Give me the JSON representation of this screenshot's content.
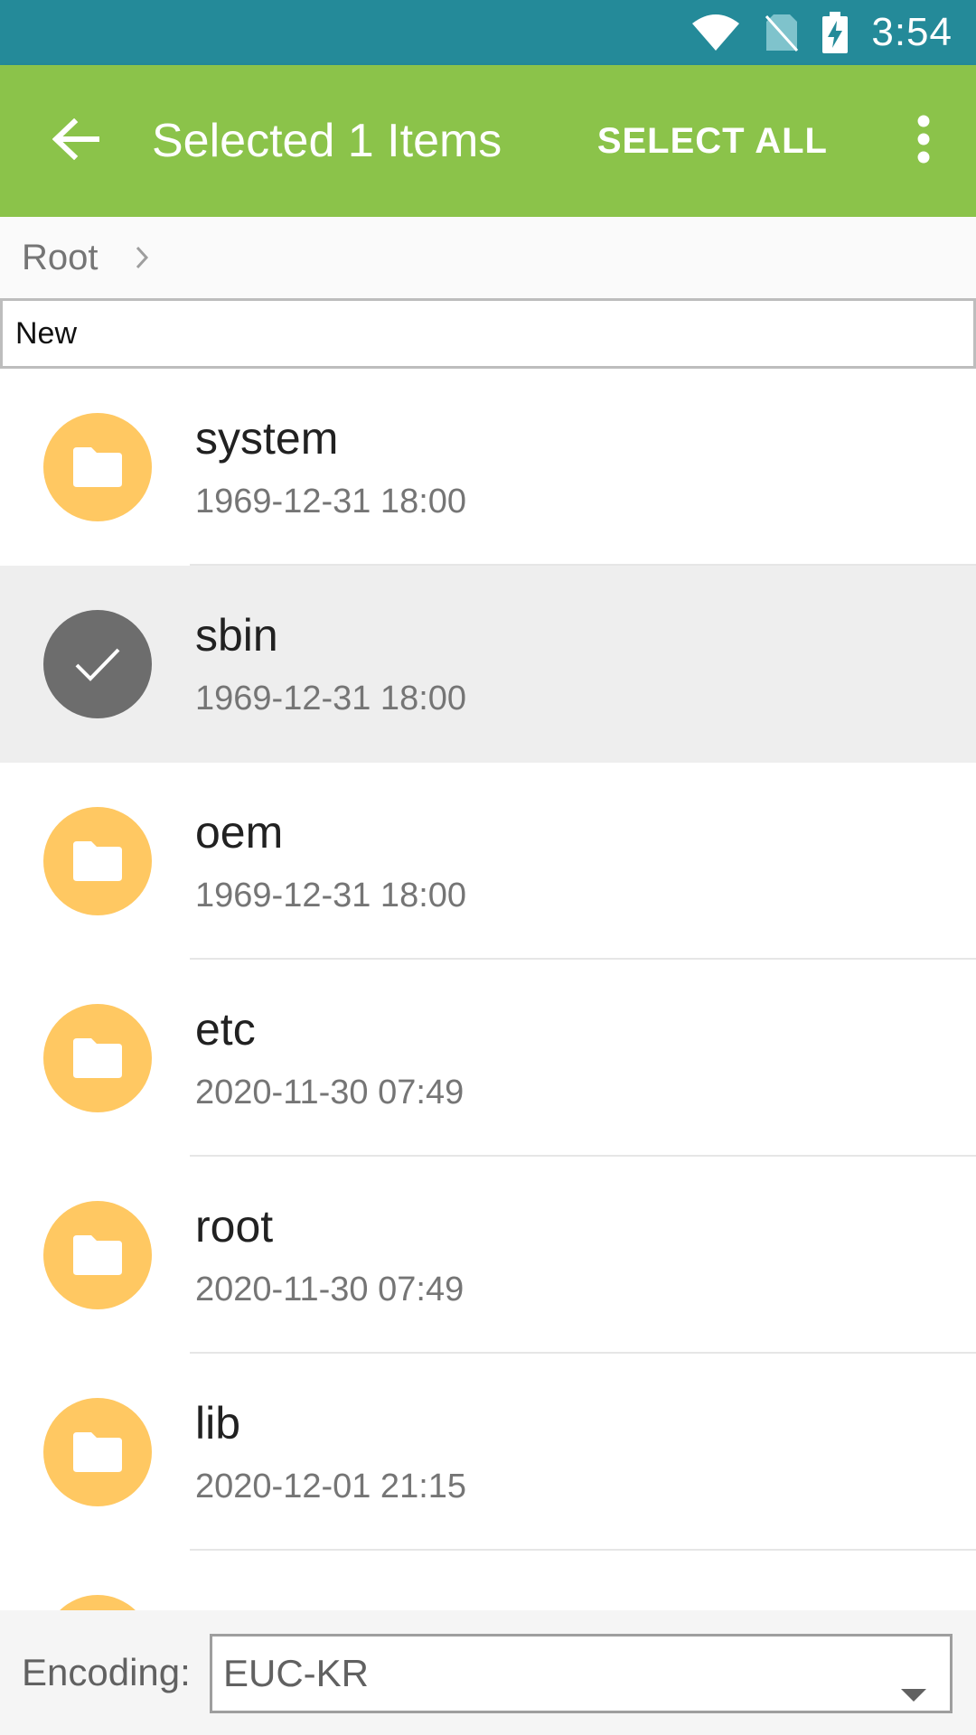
{
  "status_bar": {
    "time": "3:54",
    "icons": [
      "wifi-icon",
      "no-sim-icon",
      "battery-charging-icon"
    ]
  },
  "action_bar": {
    "title": "Selected 1 Items",
    "select_all_label": "SELECT ALL",
    "back_icon": "arrow-back-icon",
    "overflow_icon": "more-vert-icon"
  },
  "breadcrumb": {
    "root_label": "Root"
  },
  "new_box": {
    "label": "New"
  },
  "files": [
    {
      "name": "system",
      "date": "1969-12-31 18:00",
      "selected": false
    },
    {
      "name": "sbin",
      "date": "1969-12-31 18:00",
      "selected": true
    },
    {
      "name": "oem",
      "date": "1969-12-31 18:00",
      "selected": false
    },
    {
      "name": "etc",
      "date": "2020-11-30 07:49",
      "selected": false
    },
    {
      "name": "root",
      "date": "2020-11-30 07:49",
      "selected": false
    },
    {
      "name": "lib",
      "date": "2020-12-01 21:15",
      "selected": false
    }
  ],
  "encoding": {
    "label": "Encoding:",
    "value": "EUC-KR"
  },
  "colors": {
    "status_bar": "#248a99",
    "action_bar": "#8bc34a",
    "folder_avatar": "#ffc862",
    "selected_avatar": "#6d6d6d",
    "selected_row": "#eeeeee"
  }
}
